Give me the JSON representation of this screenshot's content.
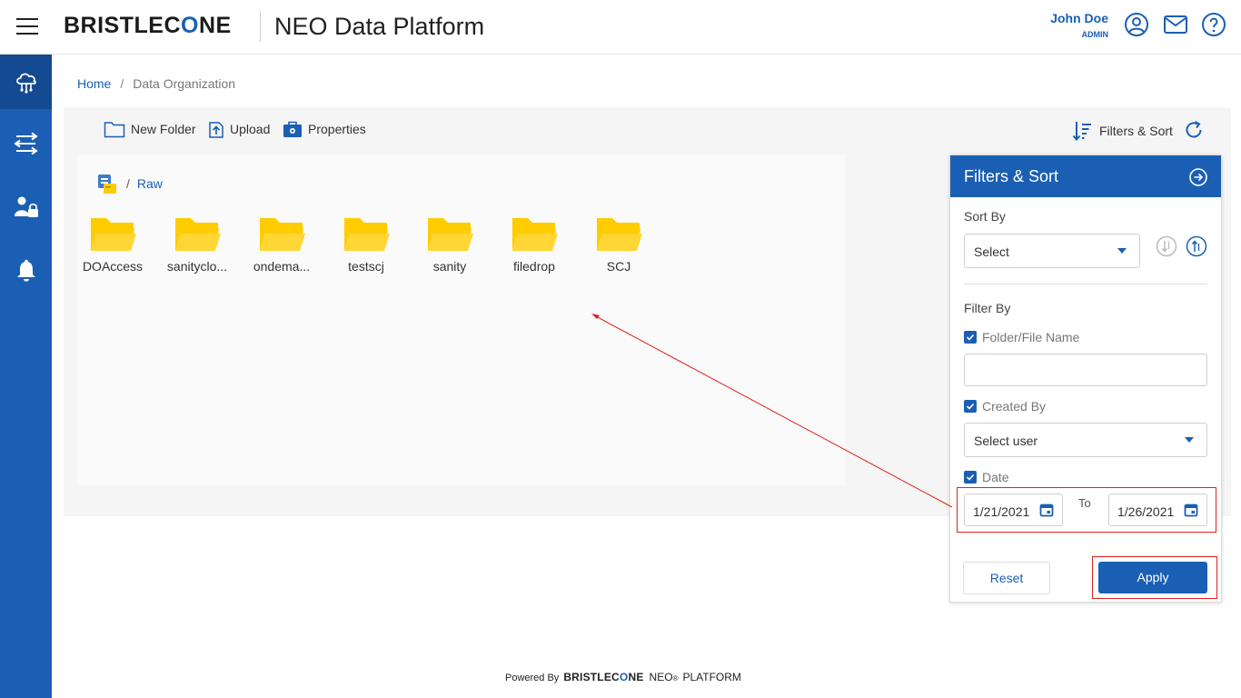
{
  "header": {
    "brand_prefix": "BRISTLEC",
    "brand_o": "O",
    "brand_suffix": "NE",
    "app_title": "NEO Data Platform",
    "user_name": "John Doe",
    "user_role": "ADMIN"
  },
  "breadcrumb": {
    "home": "Home",
    "separator": "/",
    "current": "Data Organization"
  },
  "toolbar": {
    "new_folder": "New Folder",
    "upload": "Upload",
    "properties": "Properties",
    "filters_sort": "Filters & Sort"
  },
  "path": {
    "separator": "/",
    "current": "Raw"
  },
  "folders": [
    {
      "name": "DOAccess"
    },
    {
      "name": "sanityclo..."
    },
    {
      "name": "ondema..."
    },
    {
      "name": "testscj"
    },
    {
      "name": "sanity"
    },
    {
      "name": "filedrop"
    },
    {
      "name": "SCJ"
    }
  ],
  "filter_panel": {
    "title": "Filters & Sort",
    "sort_by_label": "Sort By",
    "sort_select": "Select",
    "filter_by_label": "Filter By",
    "name_check": "Folder/File Name",
    "name_value": "",
    "created_by_check": "Created By",
    "user_select": "Select user",
    "date_check": "Date",
    "date_from": "1/21/2021",
    "to_label": "To",
    "date_to": "1/26/2021",
    "reset": "Reset",
    "apply": "Apply"
  },
  "footer": {
    "powered_by": "Powered By",
    "brand_prefix": "BRISTLEC",
    "brand_o": "O",
    "brand_suffix": "NE",
    "neo": "NEO",
    "reg": "®",
    "platform": "PLATFORM"
  },
  "colors": {
    "primary": "#1a5fb4",
    "folder": "#ffcc00",
    "annotation": "#e02020"
  }
}
